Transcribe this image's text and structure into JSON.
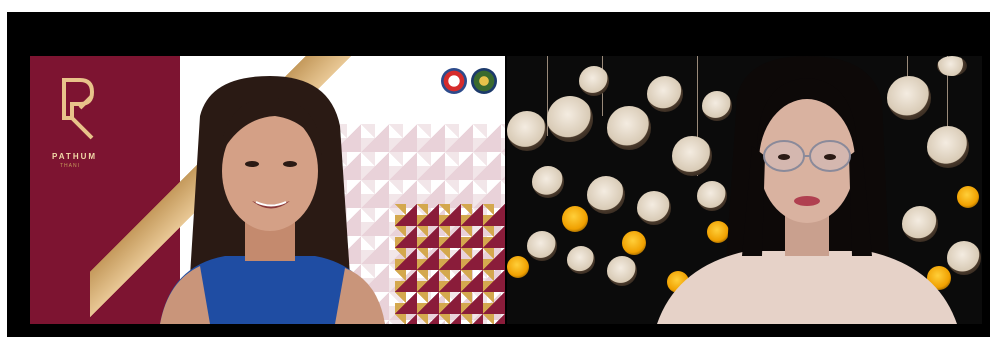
{
  "meeting": {
    "participants": [
      {
        "role": "speaker-left"
      },
      {
        "role": "speaker-right"
      }
    ]
  },
  "branding": {
    "logo_text": "PATHUM",
    "logo_subtext": "THANI",
    "colors": {
      "maroon": "#7d1431",
      "gold": "#c49a5c",
      "frame": "#000000"
    }
  },
  "icons": {
    "seal_left": "government-seal-icon",
    "seal_right": "province-emblem-icon"
  }
}
